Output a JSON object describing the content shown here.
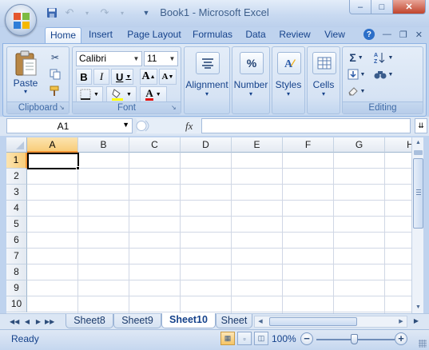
{
  "window": {
    "title": "Book1 - Microsoft Excel",
    "controls": {
      "minimize": "–",
      "maximize": "□",
      "close": "✕"
    }
  },
  "quick_access": {
    "save_icon": "save-icon",
    "undo_icon": "undo-icon",
    "redo_icon": "redo-icon",
    "customize_icon": "dropdown-icon"
  },
  "ribbon_tabs": [
    {
      "label": "Home",
      "active": true
    },
    {
      "label": "Insert"
    },
    {
      "label": "Page Layout"
    },
    {
      "label": "Formulas"
    },
    {
      "label": "Data"
    },
    {
      "label": "Review"
    },
    {
      "label": "View"
    }
  ],
  "ribbon": {
    "clipboard": {
      "group_label": "Clipboard",
      "paste_label": "Paste"
    },
    "font": {
      "group_label": "Font",
      "font_name": "Calibri",
      "font_size": "11",
      "bold": "B",
      "italic": "I",
      "underline": "U",
      "grow": "A",
      "shrink": "A",
      "font_color": "A"
    },
    "alignment": {
      "label": "Alignment"
    },
    "number": {
      "label": "Number",
      "icon_text": "%"
    },
    "styles": {
      "label": "Styles"
    },
    "cells": {
      "label": "Cells"
    },
    "editing": {
      "group_label": "Editing",
      "sum": "Σ"
    }
  },
  "formula_bar": {
    "name_box": "A1",
    "fx_label": "fx",
    "formula_value": ""
  },
  "grid": {
    "columns": [
      "A",
      "B",
      "C",
      "D",
      "E",
      "F",
      "G",
      "H"
    ],
    "rows": [
      "1",
      "2",
      "3",
      "4",
      "5",
      "6",
      "7",
      "8",
      "9",
      "10"
    ],
    "active_cell": "A1",
    "selected_column": "A",
    "selected_row": "1"
  },
  "sheets": {
    "tabs": [
      "Sheet8",
      "Sheet9",
      "Sheet10",
      "Sheet"
    ],
    "active": "Sheet10"
  },
  "status": {
    "text": "Ready",
    "zoom": "100%"
  },
  "colors": {
    "accent": "#15428b",
    "selection_orange": "#f29536",
    "close_red": "#c0432b"
  }
}
